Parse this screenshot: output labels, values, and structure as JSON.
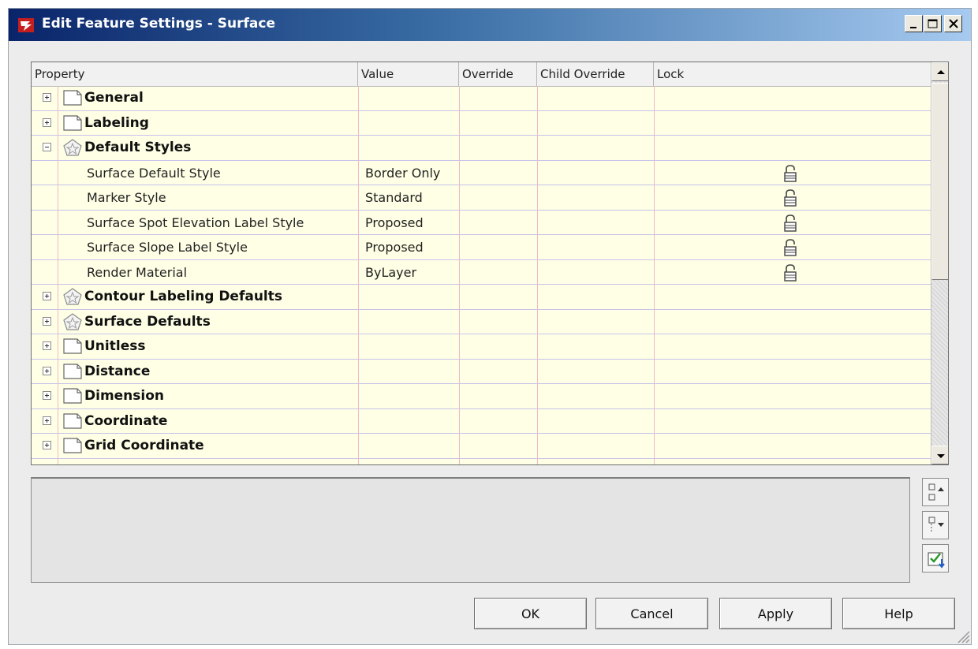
{
  "window": {
    "title": "Edit Feature Settings - Surface",
    "minimize_label": "_",
    "maximize_label": "□",
    "close_label": "X"
  },
  "grid": {
    "columns": [
      "Property",
      "Value",
      "Override",
      "Child Override",
      "Lock"
    ],
    "rows": [
      {
        "type": "category",
        "label": "General",
        "expanded": false,
        "icon": "page-icon"
      },
      {
        "type": "category",
        "label": "Labeling",
        "expanded": false,
        "icon": "page-icon"
      },
      {
        "type": "category",
        "label": "Default Styles",
        "expanded": true,
        "icon": "style-icon"
      },
      {
        "type": "property",
        "label": "Surface Default Style",
        "value": "Border Only",
        "lock": "unlocked"
      },
      {
        "type": "property",
        "label": "Marker Style",
        "value": "Standard",
        "lock": "unlocked"
      },
      {
        "type": "property",
        "label": "Surface Spot Elevation Label Style",
        "value": "Proposed",
        "lock": "unlocked"
      },
      {
        "type": "property",
        "label": "Surface Slope Label Style",
        "value": "Proposed",
        "lock": "unlocked"
      },
      {
        "type": "property",
        "label": "Render Material",
        "value": "ByLayer",
        "lock": "unlocked"
      },
      {
        "type": "category",
        "label": "Contour Labeling Defaults",
        "expanded": false,
        "icon": "style-icon"
      },
      {
        "type": "category",
        "label": "Surface Defaults",
        "expanded": false,
        "icon": "style-icon"
      },
      {
        "type": "category",
        "label": "Unitless",
        "expanded": false,
        "icon": "page-icon"
      },
      {
        "type": "category",
        "label": "Distance",
        "expanded": false,
        "icon": "page-icon"
      },
      {
        "type": "category",
        "label": "Dimension",
        "expanded": false,
        "icon": "page-icon"
      },
      {
        "type": "category",
        "label": "Coordinate",
        "expanded": false,
        "icon": "page-icon"
      },
      {
        "type": "category",
        "label": "Grid Coordinate",
        "expanded": false,
        "icon": "page-icon"
      }
    ]
  },
  "buttons": {
    "ok": "OK",
    "cancel": "Cancel",
    "apply": "Apply",
    "help": "Help"
  },
  "side_buttons": [
    "collapse-all-icon",
    "expand-all-icon",
    "apply-check-icon"
  ]
}
